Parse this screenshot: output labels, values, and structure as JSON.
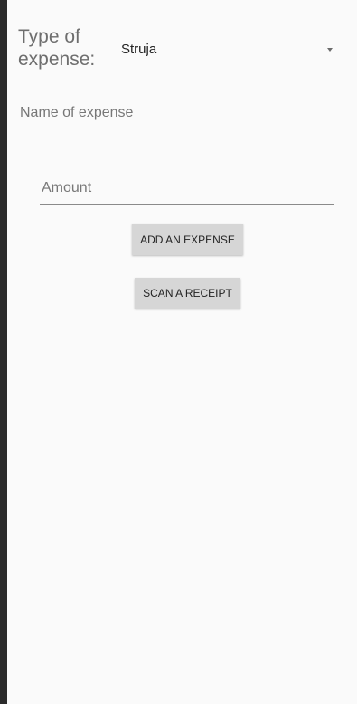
{
  "form": {
    "type_label": "Type of expense:",
    "type_selected": "Struja",
    "name_placeholder": "Name of expense",
    "amount_placeholder": "Amount"
  },
  "buttons": {
    "add_label": "ADD AN EXPENSE",
    "scan_label": "SCAN A RECEIPT"
  }
}
